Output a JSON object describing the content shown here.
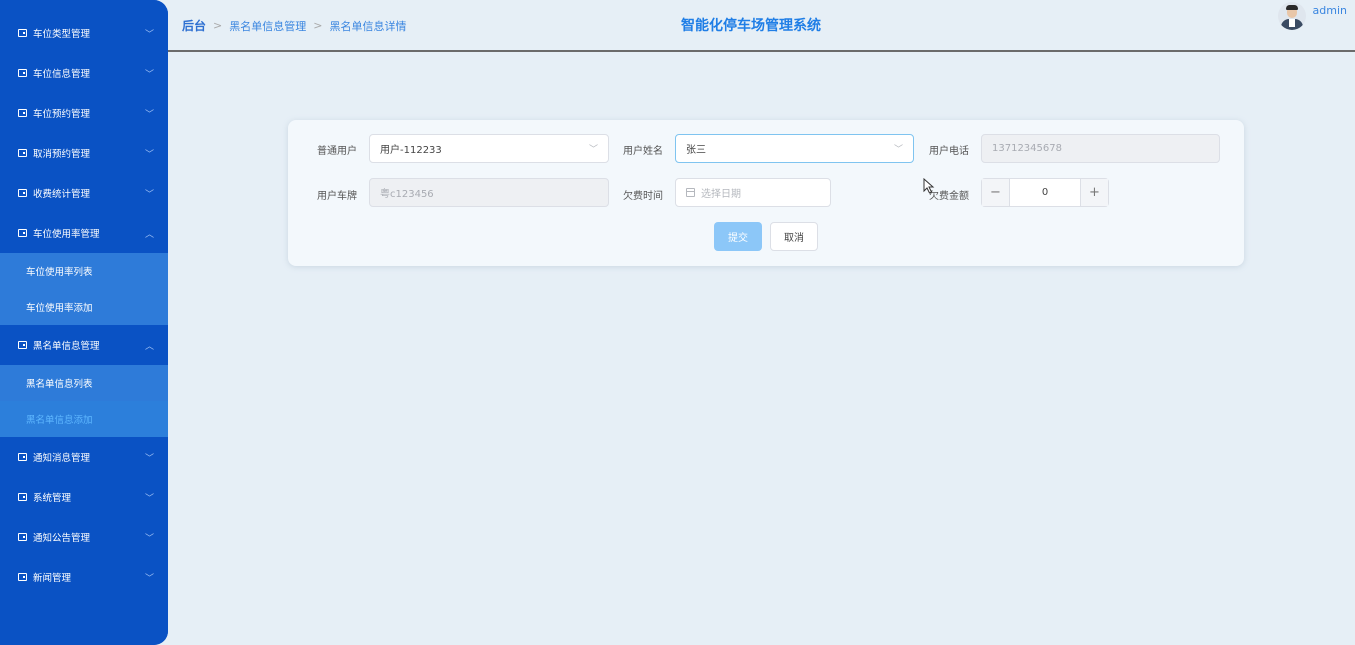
{
  "sidebar": {
    "items": [
      {
        "label": "车位类型管理",
        "expanded": false
      },
      {
        "label": "车位信息管理",
        "expanded": false
      },
      {
        "label": "车位预约管理",
        "expanded": false
      },
      {
        "label": "取消预约管理",
        "expanded": false
      },
      {
        "label": "收费统计管理",
        "expanded": false
      },
      {
        "label": "车位使用率管理",
        "expanded": true,
        "children": [
          "车位使用率列表",
          "车位使用率添加"
        ]
      },
      {
        "label": "黑名单信息管理",
        "expanded": true,
        "children": [
          "黑名单信息列表",
          "黑名单信息添加"
        ]
      },
      {
        "label": "通知消息管理",
        "expanded": false
      },
      {
        "label": "系统管理",
        "expanded": false
      },
      {
        "label": "通知公告管理",
        "expanded": false
      },
      {
        "label": "新闻管理",
        "expanded": false
      }
    ],
    "active_child": "黑名单信息添加"
  },
  "header": {
    "breadcrumb": [
      "后台",
      "黑名单信息管理",
      "黑名单信息详情"
    ],
    "title": "智能化停车场管理系统",
    "user": "admin"
  },
  "form": {
    "user_label": "普通用户",
    "user_value": "用户-112233",
    "name_label": "用户姓名",
    "name_value": "张三",
    "phone_label": "用户电话",
    "phone_value": "13712345678",
    "plate_label": "用户车牌",
    "plate_value": "粤c123456",
    "time_label": "欠费时间",
    "time_placeholder": "选择日期",
    "amount_label": "欠费金额",
    "amount_value": "0",
    "submit_label": "提交",
    "cancel_label": "取消"
  },
  "colors": {
    "sidebar": "#0a52c4",
    "submenu": "#2e7bd9",
    "accent": "#1f7ee6",
    "primary_button": "#8cc7f8"
  }
}
